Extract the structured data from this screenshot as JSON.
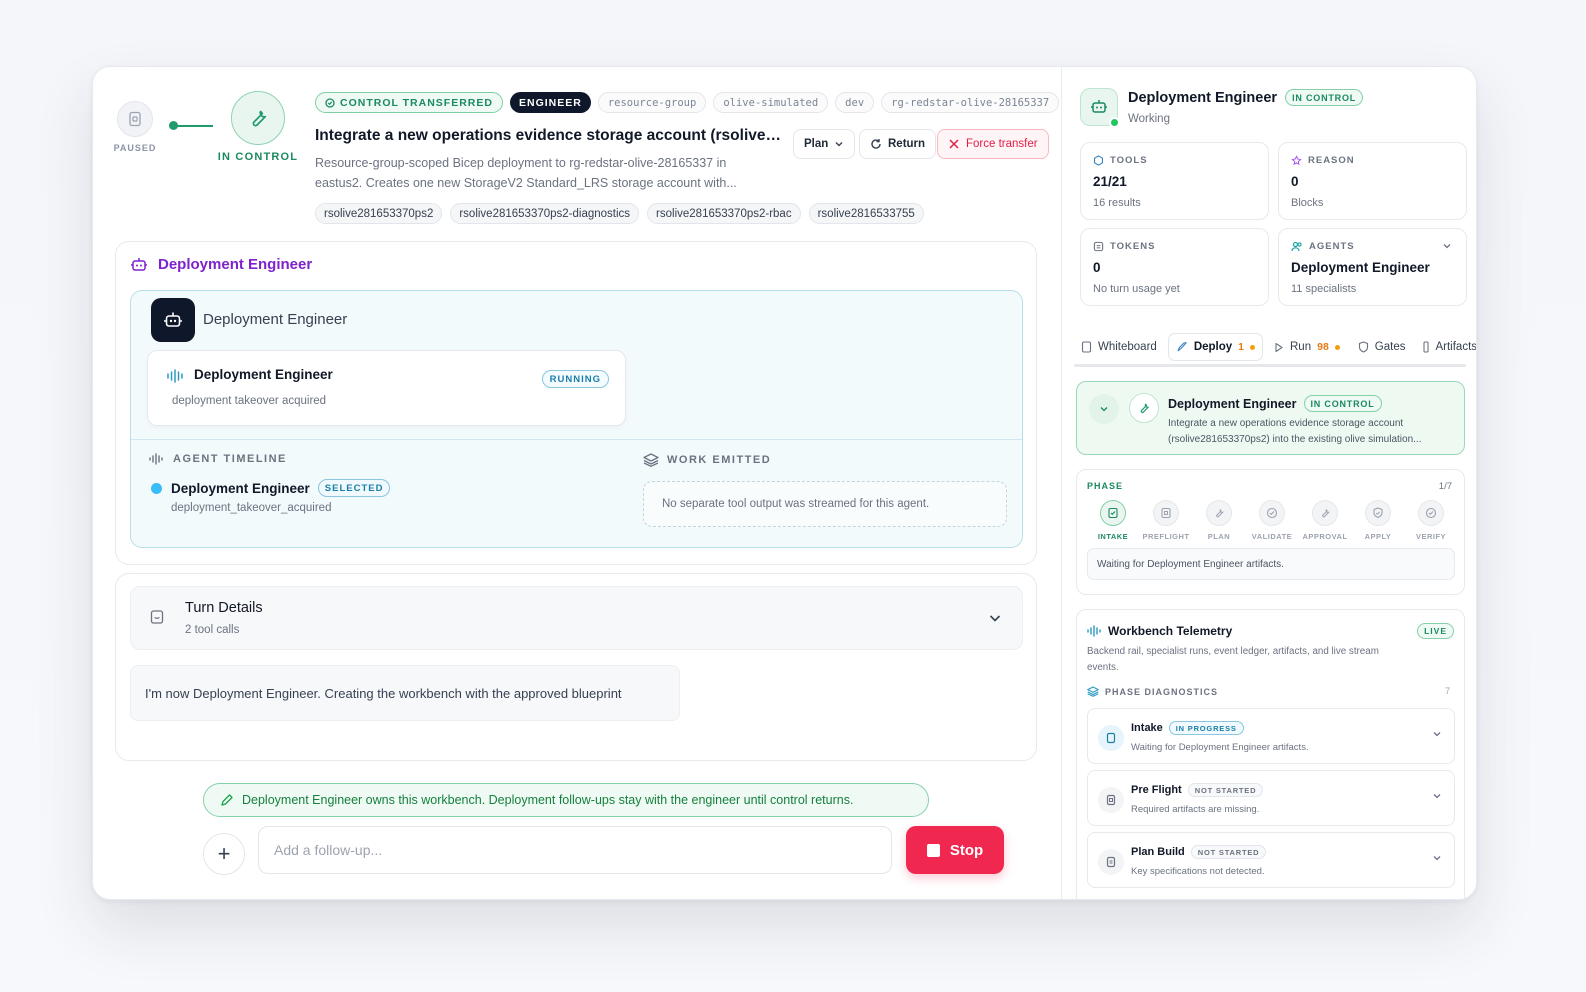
{
  "header": {
    "paused_label": "PAUSED",
    "in_control_label": "IN CONTROL",
    "pills": {
      "control": "CONTROL TRANSFERRED",
      "role": "ENGINEER",
      "meta": [
        "resource-group",
        "olive-simulated",
        "dev",
        "rg-redstar-olive-28165337"
      ]
    },
    "title": "Integrate a new operations evidence storage account (rsolive281653370ps2)",
    "subtitle": "Resource-group-scoped Bicep deployment to rg-redstar-olive-28165337 in eastus2. Creates one new StorageV2 Standard_LRS storage account with...",
    "tags": [
      "rsolive281653370ps2",
      "rsolive281653370ps2-diagnostics",
      "rsolive281653370ps2-rbac",
      "rsolive2816533755"
    ],
    "buttons": {
      "plan": "Plan",
      "return": "Return",
      "force": "Force transfer"
    }
  },
  "agent_card": {
    "heading": "Deployment Engineer",
    "inner_name": "Deployment Engineer",
    "run": {
      "title": "Deployment Engineer",
      "badge": "RUNNING",
      "sub": "deployment takeover acquired"
    },
    "timeline": {
      "label": "AGENT TIMELINE",
      "name": "Deployment Engineer",
      "badge": "SELECTED",
      "sub": "deployment_takeover_acquired"
    },
    "work": {
      "label": "WORK EMITTED",
      "empty": "No separate tool output was streamed for this agent."
    }
  },
  "turn": {
    "title": "Turn Details",
    "sub": "2 tool calls",
    "message": "I'm now Deployment Engineer. Creating the workbench with the approved blueprint"
  },
  "composer": {
    "notice": "Deployment Engineer owns this workbench. Deployment follow-ups stay with the engineer until control returns.",
    "plus": "+",
    "placeholder": "Add a follow-up...",
    "stop": "Stop"
  },
  "side": {
    "name": "Deployment Engineer",
    "badge": "IN CONTROL",
    "status": "Working",
    "stats": {
      "tools": {
        "label": "TOOLS",
        "value": "21/21",
        "sub": "16 results"
      },
      "reason": {
        "label": "REASON",
        "value": "0",
        "sub": "Blocks"
      },
      "tokens": {
        "label": "TOKENS",
        "value": "0",
        "sub": "No turn usage yet"
      },
      "agents": {
        "label": "AGENTS",
        "value": "Deployment Engineer",
        "sub": "11 specialists"
      }
    },
    "tabs": {
      "whiteboard": "Whiteboard",
      "deploy": "Deploy",
      "deploy_count": "1",
      "run": "Run",
      "run_count": "98",
      "gates": "Gates",
      "artifacts": "Artifacts"
    },
    "control_card": {
      "title": "Deployment Engineer",
      "badge": "IN CONTROL",
      "desc": "Integrate a new operations evidence storage account (rsolive281653370ps2) into the existing olive simulation..."
    },
    "phase": {
      "label": "PHASE",
      "fraction": "1/7",
      "steps": [
        "INTAKE",
        "PREFLIGHT",
        "PLAN",
        "VALIDATE",
        "APPROVAL",
        "APPLY",
        "VERIFY"
      ],
      "waiting": "Waiting for Deployment Engineer artifacts."
    },
    "telemetry": {
      "title": "Workbench Telemetry",
      "live": "LIVE",
      "desc": "Backend rail, specialist runs, event ledger, artifacts, and live stream events.",
      "diag_label": "PHASE DIAGNOSTICS",
      "diag_count": "7",
      "items": [
        {
          "name": "Intake",
          "badge": "IN PROGRESS",
          "sub": "Waiting for Deployment Engineer artifacts."
        },
        {
          "name": "Pre Flight",
          "badge": "NOT STARTED",
          "sub": "Required artifacts are missing."
        },
        {
          "name": "Plan Build",
          "badge": "NOT STARTED",
          "sub": "Key specifications not detected."
        }
      ]
    }
  },
  "colors": {
    "accent_green": "#1b8a5f",
    "accent_purple": "#7e22ce",
    "stop_red": "#f0284f",
    "info_blue": "#1a7fa8"
  }
}
